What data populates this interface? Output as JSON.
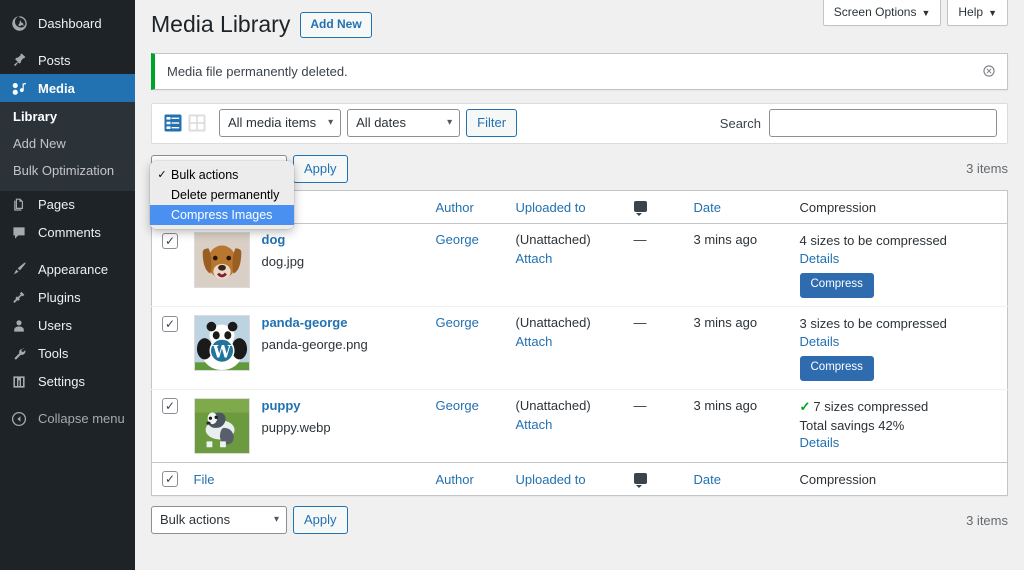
{
  "sidebar": {
    "items": [
      {
        "label": "Dashboard",
        "icon": "dashboard-icon",
        "name": "sidebar-item-dashboard",
        "current": false
      },
      {
        "label": "Posts",
        "icon": "pin-icon",
        "name": "sidebar-item-posts",
        "current": false
      },
      {
        "label": "Media",
        "icon": "media-icon",
        "name": "sidebar-item-media",
        "current": true
      },
      {
        "label": "Pages",
        "icon": "pages-icon",
        "name": "sidebar-item-pages",
        "current": false
      },
      {
        "label": "Comments",
        "icon": "comments-icon",
        "name": "sidebar-item-comments",
        "current": false
      },
      {
        "label": "Appearance",
        "icon": "brush-icon",
        "name": "sidebar-item-appearance",
        "current": false
      },
      {
        "label": "Plugins",
        "icon": "plug-icon",
        "name": "sidebar-item-plugins",
        "current": false
      },
      {
        "label": "Users",
        "icon": "user-icon",
        "name": "sidebar-item-users",
        "current": false
      },
      {
        "label": "Tools",
        "icon": "wrench-icon",
        "name": "sidebar-item-tools",
        "current": false
      },
      {
        "label": "Settings",
        "icon": "settings-icon",
        "name": "sidebar-item-settings",
        "current": false
      }
    ],
    "submenu": [
      {
        "label": "Library",
        "current": true
      },
      {
        "label": "Add New",
        "current": false
      },
      {
        "label": "Bulk Optimization",
        "current": false
      }
    ],
    "collapse_label": "Collapse menu",
    "active_color": "#2271b1"
  },
  "screen_meta": {
    "screen_options_label": "Screen Options",
    "help_label": "Help",
    "caret": "▼"
  },
  "header": {
    "title": "Media Library",
    "add_new_label": "Add New"
  },
  "notice": {
    "message": "Media file permanently deleted.",
    "accent_color": "#00a32a",
    "dismiss_icon": "close-circle-icon"
  },
  "toolbar": {
    "list_view_icon": "list-view-icon",
    "grid_view_icon": "grid-view-icon",
    "media_filter_value": "All media items",
    "dates_filter_value": "All dates",
    "filter_label": "Filter",
    "search_label": "Search",
    "search_value": "",
    "search_placeholder": ""
  },
  "bulk_top": {
    "select_value": "Bulk actions",
    "apply_label": "Apply",
    "items_count": "3 items"
  },
  "bulk_menu": {
    "open": true,
    "items": [
      {
        "label": "Bulk actions",
        "checked": true,
        "selected": false
      },
      {
        "label": "Delete permanently",
        "checked": false,
        "selected": false
      },
      {
        "label": "Compress Images",
        "checked": false,
        "selected": true
      }
    ],
    "highlight_color": "#4a90f0"
  },
  "table": {
    "columns": [
      {
        "key": "cb",
        "label": ""
      },
      {
        "key": "file",
        "label": "File"
      },
      {
        "key": "author",
        "label": "Author"
      },
      {
        "key": "uploaded",
        "label": "Uploaded to"
      },
      {
        "key": "comments",
        "label": "comment-bubble-icon"
      },
      {
        "key": "date",
        "label": "Date"
      },
      {
        "key": "compression",
        "label": "Compression"
      }
    ],
    "rows": [
      {
        "checked": true,
        "thumb": "dog-thumbnail",
        "title": "dog",
        "filename": "dog.jpg",
        "author": "George",
        "uploaded_to": "(Unattached)",
        "attach_label": "Attach",
        "comments": "—",
        "date": "3 mins ago",
        "compression_status": "4 sizes to be compressed",
        "compression_done": false,
        "savings": "",
        "details_label": "Details",
        "compress_label": "Compress"
      },
      {
        "checked": true,
        "thumb": "panda-thumbnail",
        "title": "panda-george",
        "filename": "panda-george.png",
        "author": "George",
        "uploaded_to": "(Unattached)",
        "attach_label": "Attach",
        "comments": "—",
        "date": "3 mins ago",
        "compression_status": "3 sizes to be compressed",
        "compression_done": false,
        "savings": "",
        "details_label": "Details",
        "compress_label": "Compress"
      },
      {
        "checked": true,
        "thumb": "puppy-thumbnail",
        "title": "puppy",
        "filename": "puppy.webp",
        "author": "George",
        "uploaded_to": "(Unattached)",
        "attach_label": "Attach",
        "comments": "—",
        "date": "3 mins ago",
        "compression_status": "7 sizes compressed",
        "compression_done": true,
        "savings": "Total savings 42%",
        "details_label": "Details",
        "compress_label": ""
      }
    ]
  },
  "bulk_bottom": {
    "select_value": "Bulk actions",
    "apply_label": "Apply",
    "items_count": "3 items"
  }
}
